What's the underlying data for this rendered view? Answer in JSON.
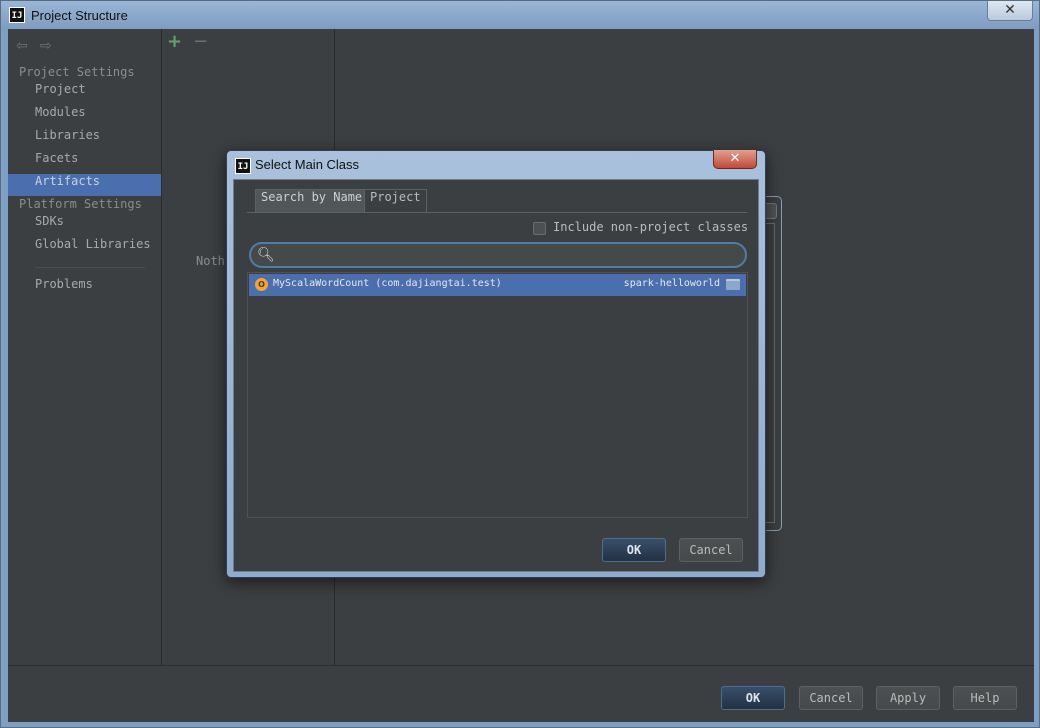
{
  "window": {
    "icon_text": "IJ",
    "title": "Project Structure",
    "close_glyph": "✕"
  },
  "sidebar": {
    "back_glyph": "⇦",
    "forward_glyph": "⇨",
    "project_settings_header": "Project Settings",
    "project_settings_items": [
      {
        "label": "Project"
      },
      {
        "label": "Modules"
      },
      {
        "label": "Libraries"
      },
      {
        "label": "Facets"
      },
      {
        "label": "Artifacts",
        "selected": true
      }
    ],
    "platform_settings_header": "Platform Settings",
    "platform_settings_items": [
      {
        "label": "SDKs"
      },
      {
        "label": "Global Libraries"
      }
    ],
    "problems_label": "Problems"
  },
  "artifacts_toolbar": {
    "add_glyph": "+",
    "remove_glyph": "−"
  },
  "artifacts_panel": {
    "empty_text": "Noth"
  },
  "footer": {
    "ok_label": "OK",
    "cancel_label": "Cancel",
    "apply_label": "Apply",
    "help_label": "Help"
  },
  "dialog": {
    "icon_text": "IJ",
    "title": "Select Main Class",
    "close_glyph": "✕",
    "tabs": [
      {
        "label": "Search by Name",
        "active": true
      },
      {
        "label": "Project",
        "active": false
      }
    ],
    "include_non_project_label": "Include non-project classes",
    "include_non_project_checked": false,
    "search": {
      "value": "",
      "placeholder": ""
    },
    "results": [
      {
        "icon_letter": "O",
        "class_name": "MyScalaWordCount (com.dajiangtai.test)",
        "module": "spark-helloworld",
        "selected": true
      }
    ],
    "ok_label": "OK",
    "cancel_label": "Cancel"
  },
  "colors": {
    "selection": "#4b6eaf",
    "background": "#3c3f41",
    "add_green": "#59a869",
    "scala_object": "#f0a732"
  }
}
